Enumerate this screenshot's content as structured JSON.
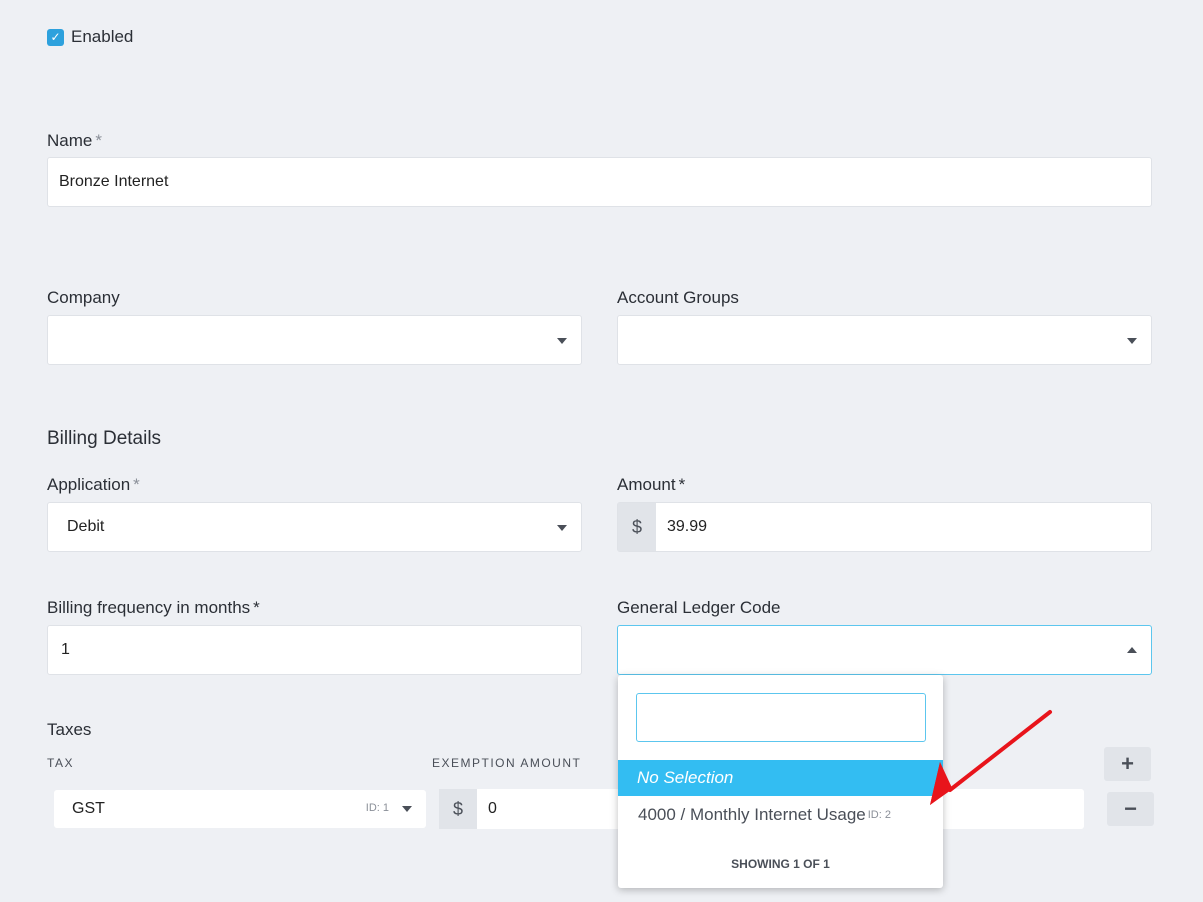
{
  "enabled": {
    "label": "Enabled",
    "checked": true
  },
  "name": {
    "label": "Name",
    "required_mark": "*",
    "value": "Bronze Internet"
  },
  "company": {
    "label": "Company",
    "value": ""
  },
  "account_groups": {
    "label": "Account Groups",
    "value": ""
  },
  "billing": {
    "section_title": "Billing Details",
    "application": {
      "label": "Application",
      "required_mark": "*",
      "value": "Debit"
    },
    "amount": {
      "label": "Amount",
      "required_mark": "*",
      "currency": "$",
      "value": "39.99"
    },
    "frequency": {
      "label": "Billing frequency in months",
      "required_mark": "*",
      "value": "1"
    },
    "gl_code": {
      "label": "General Ledger Code",
      "value": "",
      "dropdown": {
        "search_value": "",
        "no_selection": "No Selection",
        "options": [
          {
            "label": "4000 / Monthly Internet Usage",
            "id": "ID: 2"
          }
        ],
        "footer": "SHOWING 1 OF 1"
      }
    }
  },
  "taxes": {
    "title": "Taxes",
    "col_tax": "TAX",
    "col_exemption": "EXEMPTION AMOUNT",
    "row": {
      "tax": "GST",
      "tax_id": "ID: 1",
      "currency": "$",
      "exemption": "0"
    },
    "add_label": "+",
    "remove_label": "−"
  },
  "colors": {
    "accent": "#2da1dd",
    "highlight": "#33bdf2",
    "arrow": "#e8141b",
    "background": "#eef0f4"
  }
}
